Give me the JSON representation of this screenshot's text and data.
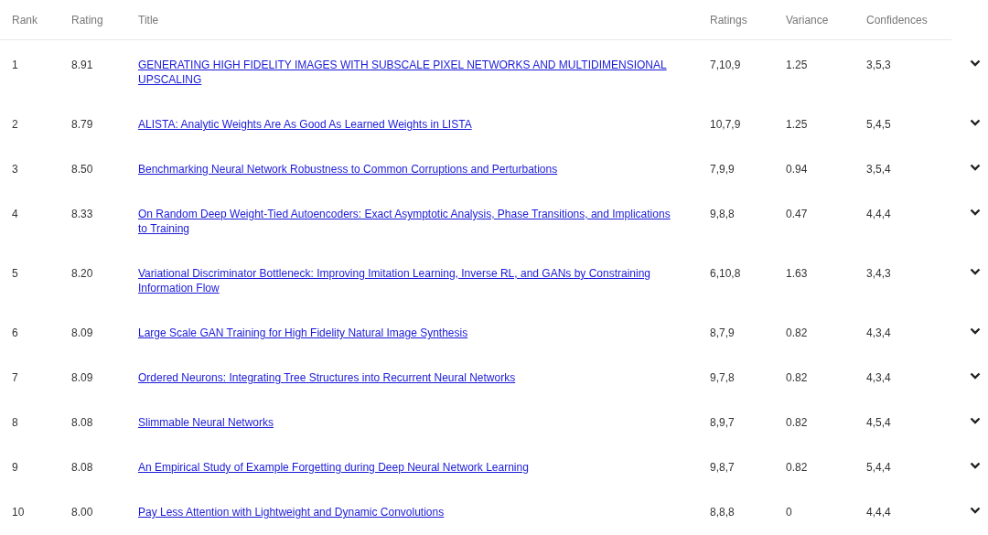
{
  "table": {
    "columns": [
      "Rank",
      "Rating",
      "Title",
      "Ratings",
      "Variance",
      "Confidences"
    ],
    "rows": [
      {
        "rank": "1",
        "rating": "8.91",
        "title": "GENERATING HIGH FIDELITY IMAGES WITH SUBSCALE PIXEL NETWORKS AND MULTIDIMENSIONAL UPSCALING",
        "ratings": "7,10,9",
        "variance": "1.25",
        "confidences": "3,5,3"
      },
      {
        "rank": "2",
        "rating": "8.79",
        "title": "ALISTA: Analytic Weights Are As Good As Learned Weights in LISTA",
        "ratings": "10,7,9",
        "variance": "1.25",
        "confidences": "5,4,5"
      },
      {
        "rank": "3",
        "rating": "8.50",
        "title": "Benchmarking Neural Network Robustness to Common Corruptions and Perturbations",
        "ratings": "7,9,9",
        "variance": "0.94",
        "confidences": "3,5,4"
      },
      {
        "rank": "4",
        "rating": "8.33",
        "title": "On Random Deep Weight-Tied Autoencoders: Exact Asymptotic Analysis, Phase Transitions, and Implications to Training",
        "ratings": "9,8,8",
        "variance": "0.47",
        "confidences": "4,4,4"
      },
      {
        "rank": "5",
        "rating": "8.20",
        "title": "Variational Discriminator Bottleneck: Improving Imitation Learning, Inverse RL, and GANs by Constraining Information Flow",
        "ratings": "6,10,8",
        "variance": "1.63",
        "confidences": "3,4,3"
      },
      {
        "rank": "6",
        "rating": "8.09",
        "title": "Large Scale GAN Training for High Fidelity Natural Image Synthesis",
        "ratings": "8,7,9",
        "variance": "0.82",
        "confidences": "4,3,4"
      },
      {
        "rank": "7",
        "rating": "8.09",
        "title": "Ordered Neurons: Integrating Tree Structures into Recurrent Neural Networks",
        "ratings": "9,7,8",
        "variance": "0.82",
        "confidences": "4,3,4"
      },
      {
        "rank": "8",
        "rating": "8.08",
        "title": "Slimmable Neural Networks",
        "ratings": "8,9,7",
        "variance": "0.82",
        "confidences": "4,5,4"
      },
      {
        "rank": "9",
        "rating": "8.08",
        "title": "An Empirical Study of Example Forgetting during Deep Neural Network Learning",
        "ratings": "9,8,7",
        "variance": "0.82",
        "confidences": "5,4,4"
      },
      {
        "rank": "10",
        "rating": "8.00",
        "title": "Pay Less Attention with Lightweight and Dynamic Convolutions",
        "ratings": "8,8,8",
        "variance": "0",
        "confidences": "4,4,4"
      }
    ]
  }
}
